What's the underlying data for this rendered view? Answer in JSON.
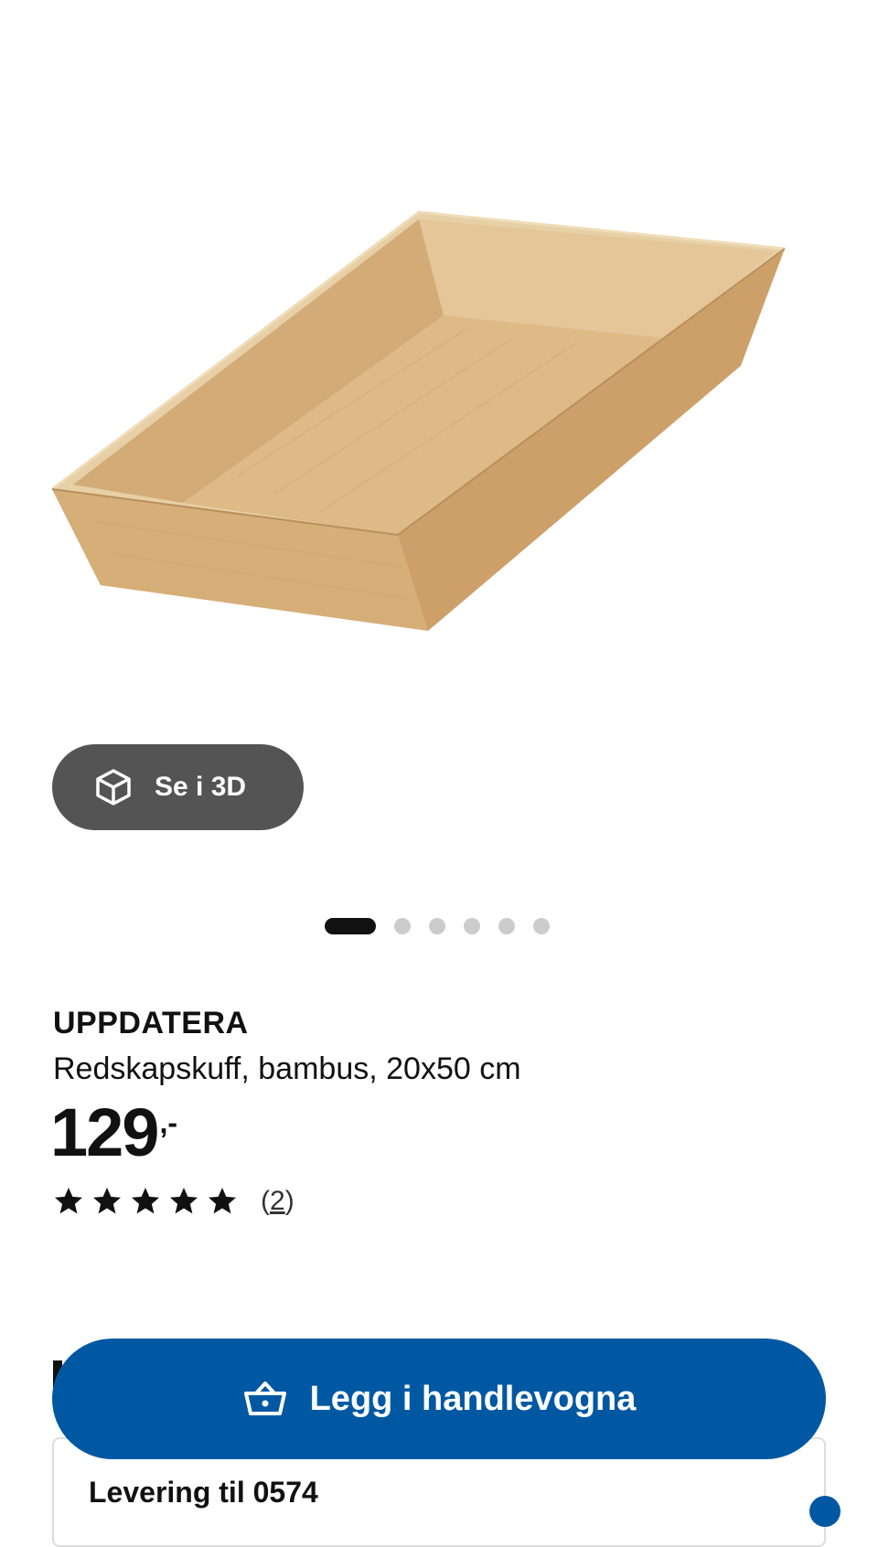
{
  "product": {
    "brand": "UPPDATERA",
    "description": "Redskapskuff, bambus, 20x50 cm",
    "price": "129",
    "price_suffix": ",-",
    "rating": {
      "stars": 5,
      "max": 5,
      "open": "(",
      "count": "2",
      "close": ")"
    }
  },
  "gallery": {
    "view_3d_label": "Se i 3D",
    "image_index": 1,
    "image_count": 6
  },
  "actions": {
    "add_to_cart_label": "Legg i handlevogna"
  },
  "delivery": {
    "label": "Levering til 0574"
  },
  "colors": {
    "brand_blue": "#0058a3",
    "button_dark": "#545454",
    "bamboo": "#d9b98a"
  },
  "icons": [
    "cube-3d-icon",
    "star-icon",
    "shopping-basket-icon"
  ]
}
